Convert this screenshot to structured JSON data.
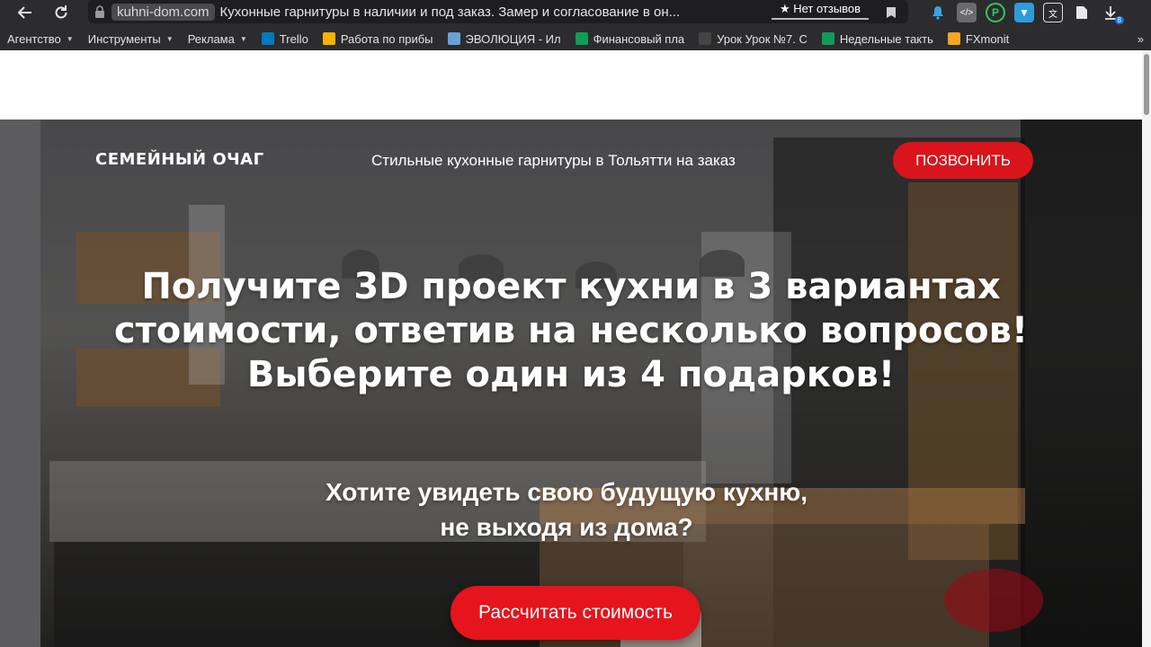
{
  "browser": {
    "domain": "kuhni-dom.com",
    "tab_title": "Кухонные гарнитуры в наличии и под заказ. Замер и согласование в он...",
    "review_chip": "★ Нет отзывов",
    "download_badge": "8",
    "bookmarks": [
      {
        "label": "Агентство",
        "dropdown": true
      },
      {
        "label": "Инструменты",
        "dropdown": true
      },
      {
        "label": "Реклама",
        "dropdown": true
      },
      {
        "label": "Trello",
        "icon_color": "#0079bf"
      },
      {
        "label": "Работа по прибы",
        "icon_color": "#f4b400"
      },
      {
        "label": "ЭВОЛЮЦИЯ - Ил",
        "icon_color": "#6aa0d8"
      },
      {
        "label": "Финансовый пла",
        "icon_color": "#0f9d58"
      },
      {
        "label": "Урок Урок №7. С",
        "icon_color": "#444444"
      },
      {
        "label": "Недельные такть",
        "icon_color": "#0f9d58"
      },
      {
        "label": "FXmonit",
        "icon_color": "#f5a623"
      }
    ]
  },
  "site": {
    "logo": "СЕМЕЙНЫЙ ОЧАГ",
    "tagline": "Стильные кухонные гарнитуры в Тольятти на заказ",
    "call_button": "ПОЗВОНИТЬ",
    "headline": "Получите 3D проект кухни в 3 вариантах стоимости, ответив на несколько вопросов! Выберите один из 4 подарков!",
    "subline_1": "Хотите увидеть свою будущую кухню,",
    "subline_2": "не выходя из дома?",
    "cta_button": "Рассчитать стоимость",
    "accent_color": "#e5141d"
  }
}
